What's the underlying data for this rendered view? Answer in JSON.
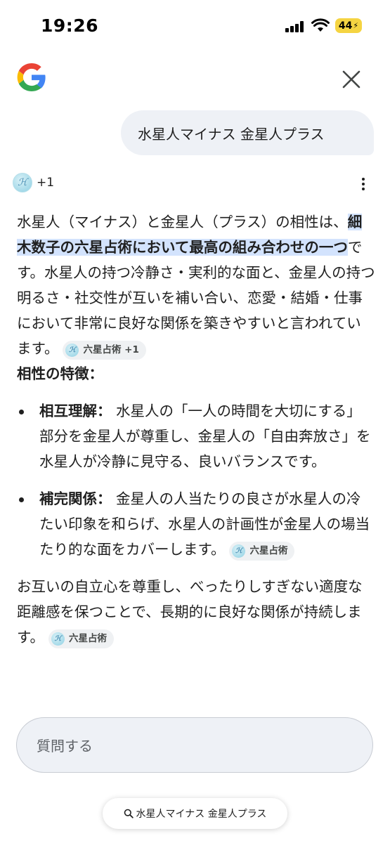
{
  "status_bar": {
    "time": "19:26",
    "battery": "44"
  },
  "query": "水星人マイナス 金星人プラス",
  "sources": {
    "count": "+1"
  },
  "answer": {
    "p1_a": "水星人（マイナス）と金星人（プラス）の相性は、",
    "p1_highlight": "細木数子の六星占術において最高の組み合わせの一つ",
    "p1_b": "です。水星人の持つ冷静さ・実利的な面と、金星人の持つ明るさ・社交性が互いを補い合い、恋愛・結婚・仕事において非常に良好な関係を築きやすいと言われています。",
    "p1_chip": "六星占術 +1",
    "section_title": "相性の特徴：",
    "bullets": [
      {
        "title": "相互理解：",
        "text": "水星人の「一人の時間を大切にする」部分を金星人が尊重し、金星人の「自由奔放さ」を水星人が冷静に見守る、良いバランスです。"
      },
      {
        "title": "補完関係：",
        "text": "金星人の人当たりの良さが水星人の冷たい印象を和らげ、水星人の計画性が金星人の場当たり的な面をカバーします。",
        "chip": "六星占術"
      }
    ],
    "closing": "お互いの自立心を尊重し、べったりしすぎない適度な距離感を保つことで、長期的に良好な関係が持続します。",
    "closing_chip": "六星占術"
  },
  "ask_placeholder": "質問する",
  "bottom_pill": "水星人マイナス 金星人プラス",
  "colors": {
    "highlight": "#d3e3fd",
    "bubble": "#eef1f6",
    "battery": "#f5d442"
  },
  "icons": [
    "google-logo",
    "close-icon",
    "more-vert-icon",
    "search-icon",
    "signal-icon",
    "wifi-icon",
    "battery-icon"
  ]
}
